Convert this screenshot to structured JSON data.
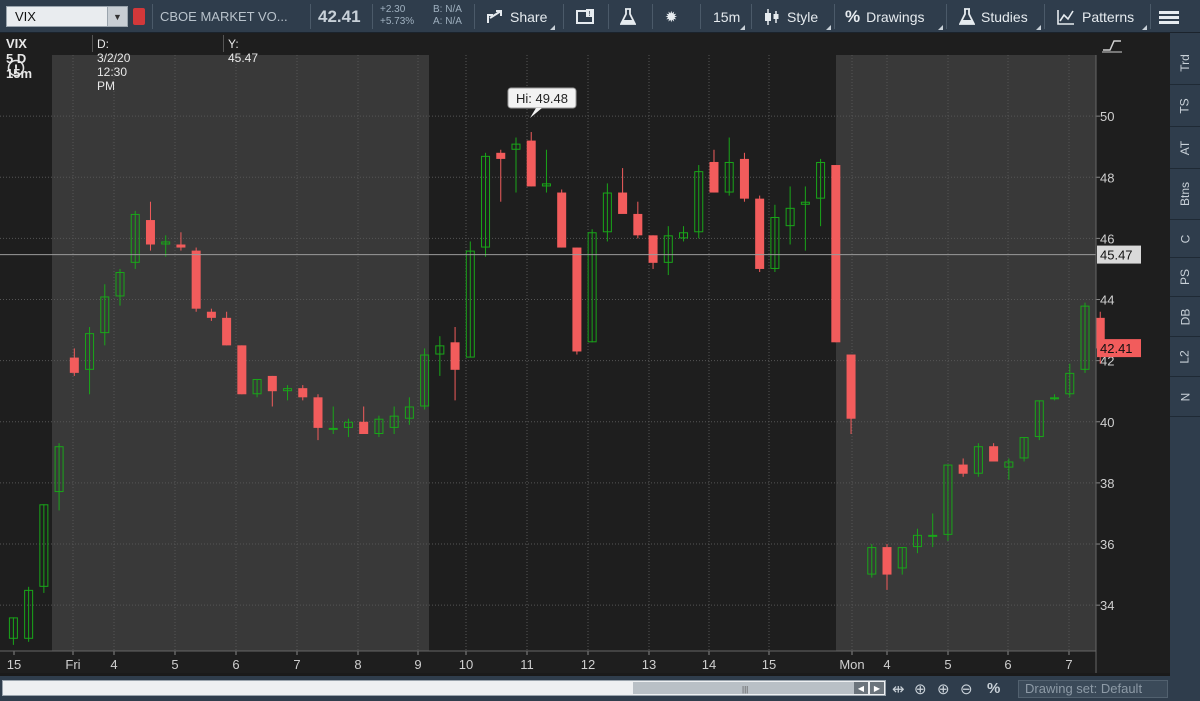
{
  "toolbar": {
    "symbol": "VIX",
    "description": "CBOE MARKET VO...",
    "last": "42.41",
    "change": "+2.30",
    "change_pct": "+5.73%",
    "bid": "B: N/A",
    "ask": "A: N/A",
    "share_label": "Share",
    "timeframe_label": "15m",
    "style_label": "Style",
    "drawings_label": "Drawings",
    "studies_label": "Studies",
    "patterns_label": "Patterns"
  },
  "chart_header": {
    "title": "VIX 5 D 15m",
    "date_readout": "D: 3/2/20 12:30 PM",
    "y_readout": "Y: 45.47"
  },
  "right_tabs": [
    "Trd",
    "TS",
    "AT",
    "Btns",
    "C",
    "PS",
    "DB",
    "L2",
    "N"
  ],
  "bottom": {
    "drawing_set": "Drawing set: Default"
  },
  "colors": {
    "up": "#19a619",
    "down": "#f25c5c",
    "toolbar": "#2f3d4c"
  },
  "chart_data": {
    "type": "candlestick",
    "title": "VIX 5 D 15m",
    "ylim": [
      32.5,
      52.0
    ],
    "y_ticks": [
      34,
      36,
      38,
      40,
      42,
      44,
      46,
      48,
      50
    ],
    "x_ticks": [
      "15",
      "Fri",
      "4",
      "5",
      "6",
      "7",
      "8",
      "9",
      "10",
      "11",
      "12",
      "13",
      "14",
      "15",
      "Mon",
      "4",
      "5",
      "6",
      "7"
    ],
    "crosshair_price": "45.47",
    "last_price_label": "42.41",
    "high_label": "Hi: 49.48",
    "candles": [
      {
        "o": 32.9,
        "h": 33.6,
        "l": 32.7,
        "c": 33.6
      },
      {
        "o": 32.9,
        "h": 34.6,
        "l": 32.8,
        "c": 34.5
      },
      {
        "o": 34.6,
        "h": 37.3,
        "l": 34.4,
        "c": 37.3
      },
      {
        "o": 37.7,
        "h": 39.3,
        "l": 37.1,
        "c": 39.2
      },
      {
        "o": 42.1,
        "h": 42.4,
        "l": 41.5,
        "c": 41.6
      },
      {
        "o": 41.7,
        "h": 43.1,
        "l": 40.9,
        "c": 42.9
      },
      {
        "o": 42.9,
        "h": 44.5,
        "l": 42.5,
        "c": 44.1
      },
      {
        "o": 44.1,
        "h": 45.0,
        "l": 43.8,
        "c": 44.9
      },
      {
        "o": 45.2,
        "h": 46.9,
        "l": 45.0,
        "c": 46.8
      },
      {
        "o": 46.6,
        "h": 47.2,
        "l": 45.6,
        "c": 45.8
      },
      {
        "o": 45.8,
        "h": 46.1,
        "l": 45.4,
        "c": 45.9
      },
      {
        "o": 45.8,
        "h": 46.2,
        "l": 45.6,
        "c": 45.7
      },
      {
        "o": 45.6,
        "h": 45.7,
        "l": 43.6,
        "c": 43.7
      },
      {
        "o": 43.6,
        "h": 43.7,
        "l": 43.3,
        "c": 43.4
      },
      {
        "o": 43.4,
        "h": 43.6,
        "l": 42.5,
        "c": 42.5
      },
      {
        "o": 42.5,
        "h": 42.5,
        "l": 40.9,
        "c": 40.9
      },
      {
        "o": 40.9,
        "h": 41.4,
        "l": 40.8,
        "c": 41.4
      },
      {
        "o": 41.5,
        "h": 41.5,
        "l": 40.5,
        "c": 41.0
      },
      {
        "o": 41.0,
        "h": 41.2,
        "l": 40.7,
        "c": 41.1
      },
      {
        "o": 41.1,
        "h": 41.2,
        "l": 40.7,
        "c": 40.8
      },
      {
        "o": 40.8,
        "h": 40.9,
        "l": 39.4,
        "c": 39.8
      },
      {
        "o": 39.8,
        "h": 40.5,
        "l": 39.6,
        "c": 39.8
      },
      {
        "o": 39.8,
        "h": 40.1,
        "l": 39.5,
        "c": 40.0
      },
      {
        "o": 40.0,
        "h": 40.5,
        "l": 39.6,
        "c": 39.6
      },
      {
        "o": 39.6,
        "h": 40.2,
        "l": 39.5,
        "c": 40.1
      },
      {
        "o": 39.8,
        "h": 40.5,
        "l": 39.6,
        "c": 40.2
      },
      {
        "o": 40.1,
        "h": 40.8,
        "l": 39.9,
        "c": 40.5
      },
      {
        "o": 40.5,
        "h": 42.4,
        "l": 40.4,
        "c": 42.2
      },
      {
        "o": 42.2,
        "h": 42.8,
        "l": 41.5,
        "c": 42.5
      },
      {
        "o": 42.6,
        "h": 43.1,
        "l": 40.7,
        "c": 41.7
      },
      {
        "o": 42.1,
        "h": 45.9,
        "l": 42.1,
        "c": 45.6
      },
      {
        "o": 45.7,
        "h": 48.8,
        "l": 45.4,
        "c": 48.7
      },
      {
        "o": 48.8,
        "h": 48.9,
        "l": 47.2,
        "c": 48.6
      },
      {
        "o": 48.9,
        "h": 49.3,
        "l": 47.5,
        "c": 49.1
      },
      {
        "o": 49.2,
        "h": 49.48,
        "l": 47.7,
        "c": 47.7
      },
      {
        "o": 47.7,
        "h": 48.9,
        "l": 47.5,
        "c": 47.8
      },
      {
        "o": 47.5,
        "h": 47.6,
        "l": 45.7,
        "c": 45.7
      },
      {
        "o": 45.7,
        "h": 45.7,
        "l": 42.2,
        "c": 42.3
      },
      {
        "o": 42.6,
        "h": 46.3,
        "l": 42.6,
        "c": 46.2
      },
      {
        "o": 46.2,
        "h": 47.8,
        "l": 45.9,
        "c": 47.5
      },
      {
        "o": 47.5,
        "h": 48.3,
        "l": 46.9,
        "c": 46.8
      },
      {
        "o": 46.8,
        "h": 47.2,
        "l": 46.0,
        "c": 46.1
      },
      {
        "o": 46.1,
        "h": 46.1,
        "l": 45.0,
        "c": 45.2
      },
      {
        "o": 45.2,
        "h": 46.4,
        "l": 44.8,
        "c": 46.1
      },
      {
        "o": 46.0,
        "h": 46.4,
        "l": 45.9,
        "c": 46.2
      },
      {
        "o": 46.2,
        "h": 48.4,
        "l": 46.0,
        "c": 48.2
      },
      {
        "o": 48.5,
        "h": 48.9,
        "l": 47.5,
        "c": 47.5
      },
      {
        "o": 47.5,
        "h": 49.3,
        "l": 47.4,
        "c": 48.5
      },
      {
        "o": 48.6,
        "h": 48.8,
        "l": 47.2,
        "c": 47.3
      },
      {
        "o": 47.3,
        "h": 47.4,
        "l": 44.9,
        "c": 45.0
      },
      {
        "o": 45.0,
        "h": 47.1,
        "l": 44.9,
        "c": 46.7
      },
      {
        "o": 46.4,
        "h": 47.7,
        "l": 45.8,
        "c": 47.0
      },
      {
        "o": 47.1,
        "h": 47.7,
        "l": 45.6,
        "c": 47.2
      },
      {
        "o": 47.3,
        "h": 48.6,
        "l": 46.4,
        "c": 48.5
      },
      {
        "o": 48.4,
        "h": 48.4,
        "l": 42.6,
        "c": 42.6
      },
      {
        "o": 42.2,
        "h": 42.2,
        "l": 39.6,
        "c": 40.1
      },
      {
        "o": 35.0,
        "h": 36.0,
        "l": 34.9,
        "c": 35.9
      },
      {
        "o": 35.9,
        "h": 36.0,
        "l": 34.5,
        "c": 35.0
      },
      {
        "o": 35.2,
        "h": 35.9,
        "l": 35.0,
        "c": 35.9
      },
      {
        "o": 35.9,
        "h": 36.5,
        "l": 35.7,
        "c": 36.3
      },
      {
        "o": 36.3,
        "h": 37.0,
        "l": 35.9,
        "c": 36.3
      },
      {
        "o": 36.3,
        "h": 38.6,
        "l": 36.1,
        "c": 38.6
      },
      {
        "o": 38.6,
        "h": 38.8,
        "l": 38.2,
        "c": 38.3
      },
      {
        "o": 38.3,
        "h": 39.3,
        "l": 38.2,
        "c": 39.2
      },
      {
        "o": 39.2,
        "h": 39.3,
        "l": 38.7,
        "c": 38.7
      },
      {
        "o": 38.5,
        "h": 38.8,
        "l": 38.1,
        "c": 38.7
      },
      {
        "o": 38.8,
        "h": 39.5,
        "l": 38.7,
        "c": 39.5
      },
      {
        "o": 39.5,
        "h": 40.7,
        "l": 39.4,
        "c": 40.7
      },
      {
        "o": 40.8,
        "h": 40.9,
        "l": 40.7,
        "c": 40.8
      },
      {
        "o": 40.9,
        "h": 41.9,
        "l": 40.8,
        "c": 41.6
      },
      {
        "o": 41.7,
        "h": 43.9,
        "l": 41.6,
        "c": 43.8
      },
      {
        "o": 43.4,
        "h": 43.6,
        "l": 41.9,
        "c": 42.4
      },
      {
        "o": 42.4,
        "h": 42.5,
        "l": 42.3,
        "c": 42.4
      }
    ]
  }
}
